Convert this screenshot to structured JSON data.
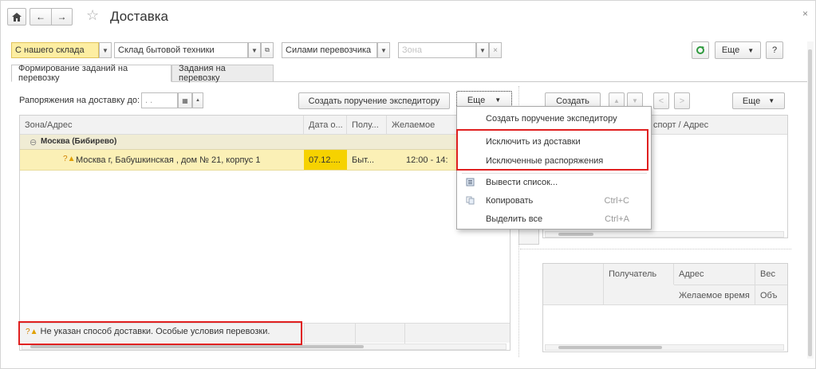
{
  "window": {
    "title": "Доставка",
    "close_glyph": "×"
  },
  "toolbar": {
    "home_icon": "home-icon",
    "back_glyph": "←",
    "forward_glyph": "→",
    "star_glyph": "☆",
    "refresh_icon": "refresh-icon",
    "more_label": "Еще",
    "help_label": "?"
  },
  "filters": {
    "source": "С нашего склада",
    "warehouse": "Склад бытовой техники",
    "carrier": "Силами перевозчика",
    "zone_placeholder": "Зона",
    "clear_glyph": "×"
  },
  "tabs": [
    {
      "label": "Формирование заданий на перевозку",
      "active": true
    },
    {
      "label": "Задания на перевозку",
      "active": false
    }
  ],
  "left": {
    "deadline_label": "Рапоряжения на доставку до:",
    "date_value": " .  .",
    "create_button": "Создать поручение экспедитору",
    "more_button": "Еще",
    "columns": [
      "Зона/Адрес",
      "Дата о...",
      "Полу...",
      "Желаемое"
    ],
    "group": {
      "glyph": "⊖",
      "label": "Москва (Бибирево)"
    },
    "row": {
      "icon_glyph": "?",
      "address": "Москва г, Бабушкинская , дом № 21, корпус 1",
      "date": "07.12....",
      "recipient": "Быт...",
      "time": "12:00 - 14:"
    },
    "footer_warning": "Не указан способ доставки. Особые условия перевозки."
  },
  "right": {
    "create_button": "Создать",
    "more_button": "Еще",
    "top_header": "спорт / Адрес",
    "bottom_columns": [
      "Получатель",
      "Адрес",
      "Вес"
    ],
    "bottom_subcolumns": [
      "Желаемое время",
      "Объ"
    ]
  },
  "menu": {
    "items": [
      {
        "label": "Создать поручение экспедитору",
        "shortcut": "",
        "icon": ""
      },
      {
        "label": "Исключить из доставки",
        "shortcut": "",
        "icon": ""
      },
      {
        "label": "Исключенные распоряжения",
        "shortcut": "",
        "icon": ""
      },
      {
        "label": "Вывести список...",
        "shortcut": "",
        "icon": "list-output-icon"
      },
      {
        "label": "Копировать",
        "shortcut": "Ctrl+C",
        "icon": "copy-icon"
      },
      {
        "label": "Выделить все",
        "shortcut": "Ctrl+A",
        "icon": ""
      }
    ]
  },
  "colors": {
    "accent_yellow": "#fdeea2",
    "highlight_red": "#e02020",
    "refresh_green": "#2e9a3e"
  }
}
